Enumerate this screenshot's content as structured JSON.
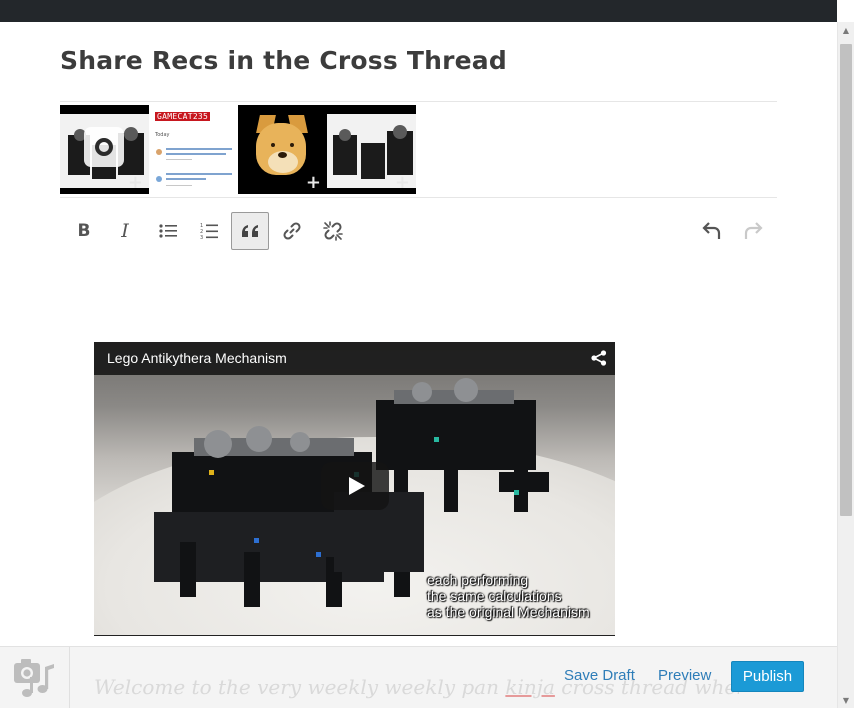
{
  "post": {
    "title": "Share Recs in the Cross Thread",
    "body_preview_before": "Welcome to the very weekly weekly pan ",
    "body_preview_link": "kinja",
    "body_preview_after": " cross thread where o"
  },
  "thumbnails": [
    {
      "name": "lego-mechanism-thumb",
      "icon": "camera-icon",
      "plus": "+"
    },
    {
      "name": "gamecat-screenshot-thumb",
      "header": "GAMECAT235",
      "today": "Today",
      "plus": "+"
    },
    {
      "name": "doge-thumb",
      "plus": "+"
    },
    {
      "name": "lego-mechanism-thumb-2",
      "plus": "+"
    }
  ],
  "toolbar": {
    "bold_label": "B",
    "italic_label": "I",
    "bullet_list_icon": "bulleted-list-icon",
    "numbered_list_icon": "numbered-list-icon",
    "quote_label": "“",
    "link_icon": "link-icon",
    "unlink_icon": "unlink-icon",
    "undo_icon": "undo-icon",
    "redo_icon": "redo-icon"
  },
  "video": {
    "title": "Lego Antikythera Mechanism",
    "caption": "each performing\nthe same calculations\nas the original Mechanism"
  },
  "footer": {
    "save_draft": "Save Draft",
    "preview": "Preview",
    "publish": "Publish"
  },
  "colors": {
    "topbar": "#23272b",
    "accent": "#1b9ad6",
    "link": "#2e7db8",
    "title": "#3c3c3c"
  }
}
